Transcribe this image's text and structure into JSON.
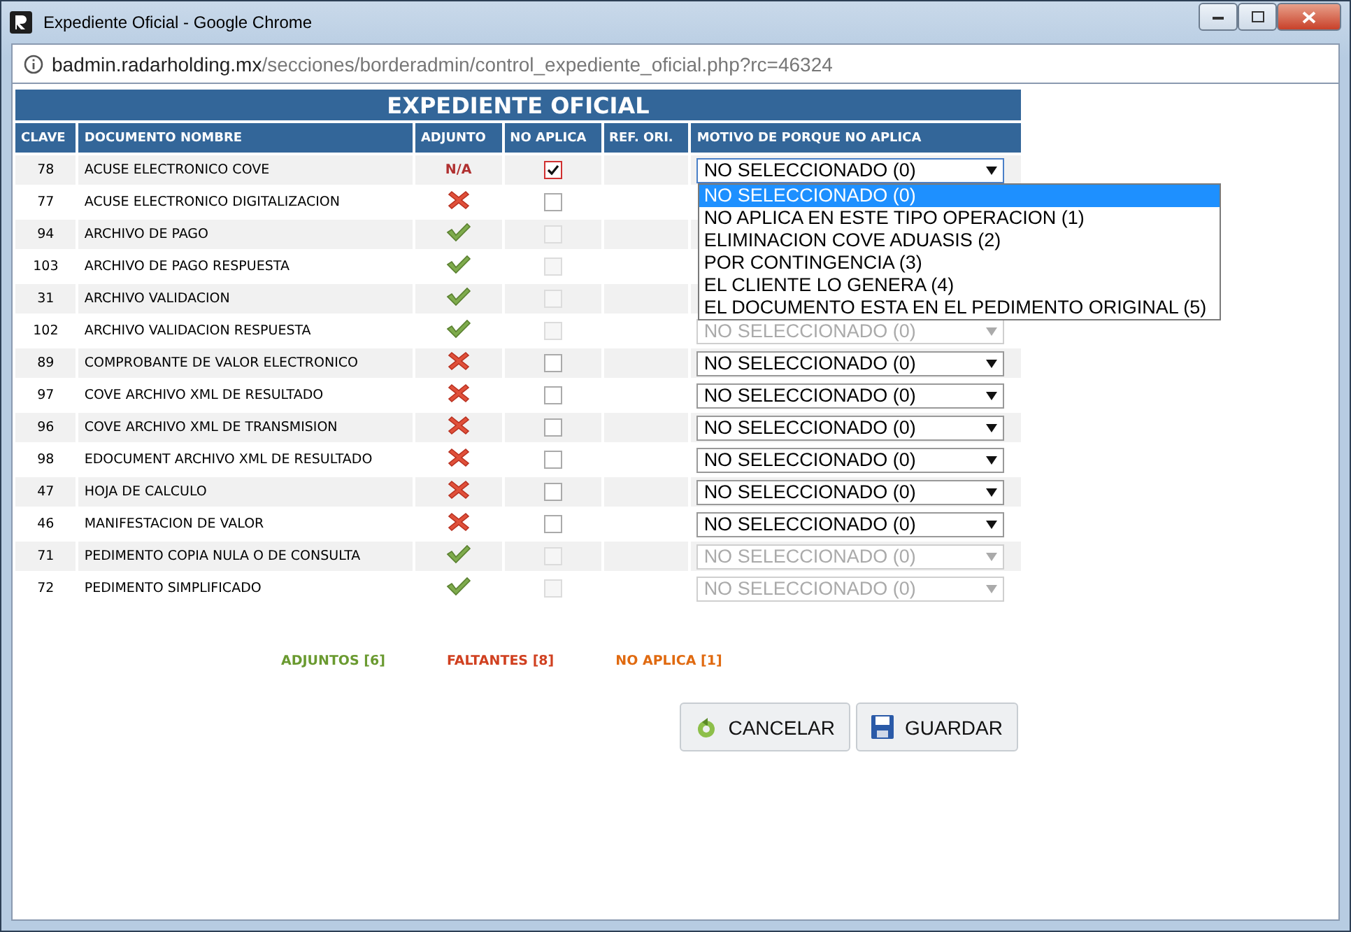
{
  "window": {
    "title": "Expediente Oficial - Google Chrome"
  },
  "address": {
    "host": "badmin.radarholding.mx",
    "path": "/secciones/borderadmin/control_expediente_oficial.php?rc=46324"
  },
  "table": {
    "title": "EXPEDIENTE OFICIAL",
    "columns": [
      "CLAVE",
      "DOCUMENTO NOMBRE",
      "ADJUNTO",
      "NO APLICA",
      "REF. ORI.",
      "MOTIVO DE PORQUE NO APLICA"
    ],
    "rows": [
      {
        "clave": "78",
        "nombre": "ACUSE ELECTRONICO COVE",
        "adjunto": {
          "kind": "na",
          "text": "N/A"
        },
        "no_aplica": {
          "checked": true,
          "disabled": false
        },
        "motivo": {
          "value": "NO SELECCIONADO (0)",
          "disabled": false,
          "expanded": true
        }
      },
      {
        "clave": "77",
        "nombre": "ACUSE ELECTRONICO DIGITALIZACION",
        "adjunto": {
          "kind": "missing"
        },
        "no_aplica": {
          "checked": false,
          "disabled": false
        }
      },
      {
        "clave": "94",
        "nombre": "ARCHIVO DE PAGO",
        "adjunto": {
          "kind": "attached"
        },
        "no_aplica": {
          "checked": false,
          "disabled": true
        }
      },
      {
        "clave": "103",
        "nombre": "ARCHIVO DE PAGO RESPUESTA",
        "adjunto": {
          "kind": "attached"
        },
        "no_aplica": {
          "checked": false,
          "disabled": true
        }
      },
      {
        "clave": "31",
        "nombre": "ARCHIVO VALIDACION",
        "adjunto": {
          "kind": "attached"
        },
        "no_aplica": {
          "checked": false,
          "disabled": true
        }
      },
      {
        "clave": "102",
        "nombre": "ARCHIVO VALIDACION RESPUESTA",
        "adjunto": {
          "kind": "attached"
        },
        "no_aplica": {
          "checked": false,
          "disabled": true
        },
        "motivo": {
          "value": "NO SELECCIONADO (0)",
          "disabled": true,
          "expanded": false
        }
      },
      {
        "clave": "89",
        "nombre": "COMPROBANTE DE VALOR ELECTRONICO",
        "adjunto": {
          "kind": "missing"
        },
        "no_aplica": {
          "checked": false,
          "disabled": false
        },
        "motivo": {
          "value": "NO SELECCIONADO (0)",
          "disabled": false,
          "expanded": false
        }
      },
      {
        "clave": "97",
        "nombre": "COVE ARCHIVO XML DE RESULTADO",
        "adjunto": {
          "kind": "missing"
        },
        "no_aplica": {
          "checked": false,
          "disabled": false
        },
        "motivo": {
          "value": "NO SELECCIONADO (0)",
          "disabled": false,
          "expanded": false
        }
      },
      {
        "clave": "96",
        "nombre": "COVE ARCHIVO XML DE TRANSMISION",
        "adjunto": {
          "kind": "missing"
        },
        "no_aplica": {
          "checked": false,
          "disabled": false
        },
        "motivo": {
          "value": "NO SELECCIONADO (0)",
          "disabled": false,
          "expanded": false
        }
      },
      {
        "clave": "98",
        "nombre": "EDOCUMENT ARCHIVO XML DE RESULTADO",
        "adjunto": {
          "kind": "missing"
        },
        "no_aplica": {
          "checked": false,
          "disabled": false
        },
        "motivo": {
          "value": "NO SELECCIONADO (0)",
          "disabled": false,
          "expanded": false
        }
      },
      {
        "clave": "47",
        "nombre": "HOJA DE CALCULO",
        "adjunto": {
          "kind": "missing"
        },
        "no_aplica": {
          "checked": false,
          "disabled": false
        },
        "motivo": {
          "value": "NO SELECCIONADO (0)",
          "disabled": false,
          "expanded": false
        }
      },
      {
        "clave": "46",
        "nombre": "MANIFESTACION DE VALOR",
        "adjunto": {
          "kind": "missing"
        },
        "no_aplica": {
          "checked": false,
          "disabled": false
        },
        "motivo": {
          "value": "NO SELECCIONADO (0)",
          "disabled": false,
          "expanded": false
        }
      },
      {
        "clave": "71",
        "nombre": "PEDIMENTO COPIA NULA O DE CONSULTA",
        "adjunto": {
          "kind": "attached"
        },
        "no_aplica": {
          "checked": false,
          "disabled": true
        },
        "motivo": {
          "value": "NO SELECCIONADO (0)",
          "disabled": true,
          "expanded": false
        }
      },
      {
        "clave": "72",
        "nombre": "PEDIMENTO SIMPLIFICADO",
        "adjunto": {
          "kind": "attached"
        },
        "no_aplica": {
          "checked": false,
          "disabled": true
        },
        "motivo": {
          "value": "NO SELECCIONADO (0)",
          "disabled": true,
          "expanded": false
        }
      }
    ]
  },
  "dropdown_options": [
    {
      "label": "NO SELECCIONADO (0)",
      "selected": true
    },
    {
      "label": "NO APLICA EN ESTE TIPO OPERACION (1)",
      "selected": false
    },
    {
      "label": "ELIMINACION COVE ADUASIS (2)",
      "selected": false
    },
    {
      "label": "POR CONTINGENCIA (3)",
      "selected": false
    },
    {
      "label": "EL CLIENTE LO GENERA (4)",
      "selected": false
    },
    {
      "label": "EL DOCUMENTO ESTA EN EL PEDIMENTO ORIGINAL (5)",
      "selected": false
    }
  ],
  "summary": [
    {
      "text": "ADJUNTOS [6]",
      "color": "#6a9a30"
    },
    {
      "text": "FALTANTES [8]",
      "color": "#d04020"
    },
    {
      "text": "NO APLICA [1]",
      "color": "#e06a10"
    }
  ],
  "buttons": [
    {
      "kind": "cancel",
      "label": "CANCELAR"
    },
    {
      "kind": "save",
      "label": "GUARDAR"
    }
  ]
}
